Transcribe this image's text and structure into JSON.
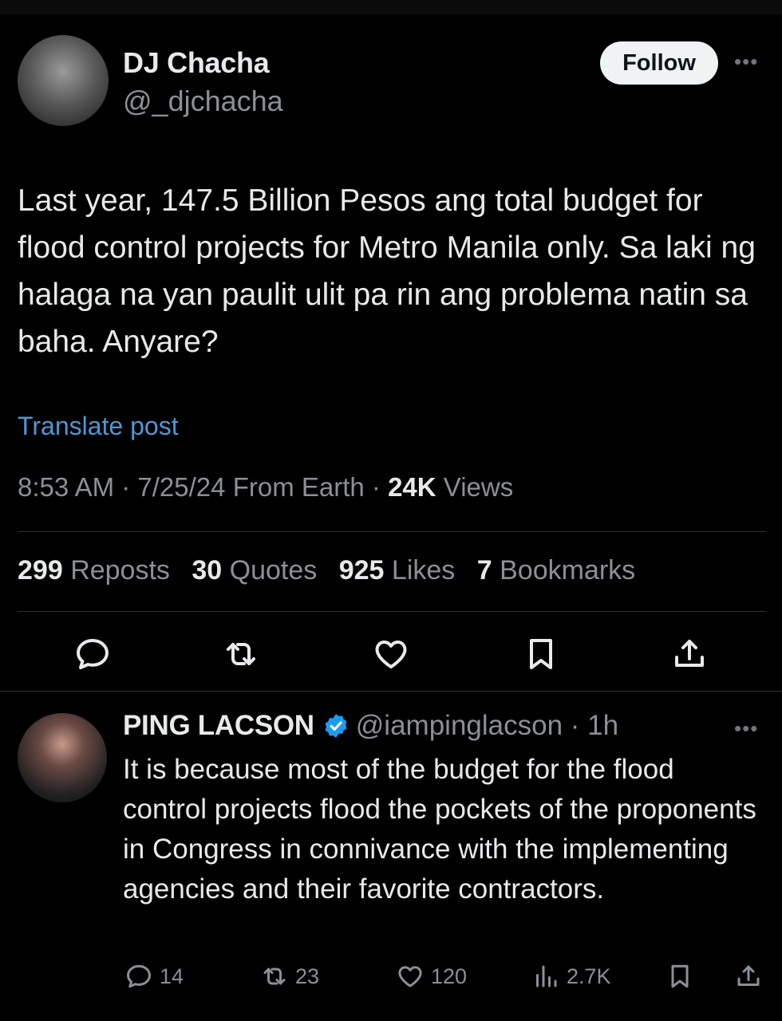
{
  "tweet": {
    "author_name": "DJ Chacha",
    "author_handle": "@_djchacha",
    "follow_label": "Follow",
    "text": "Last year, 147.5 Billion Pesos ang total budget for flood control projects for Metro Manila only. Sa laki ng halaga na yan paulit ulit pa rin ang problema natin sa baha. Anyare?",
    "translate_label": "Translate post",
    "time": "8:53 AM",
    "date": "7/25/24",
    "location": "From Earth",
    "views_count": "24K",
    "views_label": "Views",
    "stats": {
      "reposts_count": "299",
      "reposts_label": "Reposts",
      "quotes_count": "30",
      "quotes_label": "Quotes",
      "likes_count": "925",
      "likes_label": "Likes",
      "bookmarks_count": "7",
      "bookmarks_label": "Bookmarks"
    },
    "actions": [
      "reply-icon",
      "repost-icon",
      "like-icon",
      "bookmark-icon",
      "share-icon"
    ]
  },
  "reply": {
    "author_name": "PING LACSON",
    "verified": true,
    "author_handle": "@iampinglacson",
    "time_ago": "1h",
    "text": "It is because most of the budget for the flood control projects flood the pockets of the proponents in Congress in connivance with the implementing agencies and their favorite contractors.",
    "counts": {
      "replies": "14",
      "reposts": "23",
      "likes": "120",
      "views": "2.7K"
    }
  },
  "colors": {
    "background": "#000000",
    "text": "#e7e9ea",
    "muted": "#8b9096",
    "link": "#4f97d6",
    "verified": "#1d9bf0",
    "follow_bg": "#eff3f4"
  }
}
